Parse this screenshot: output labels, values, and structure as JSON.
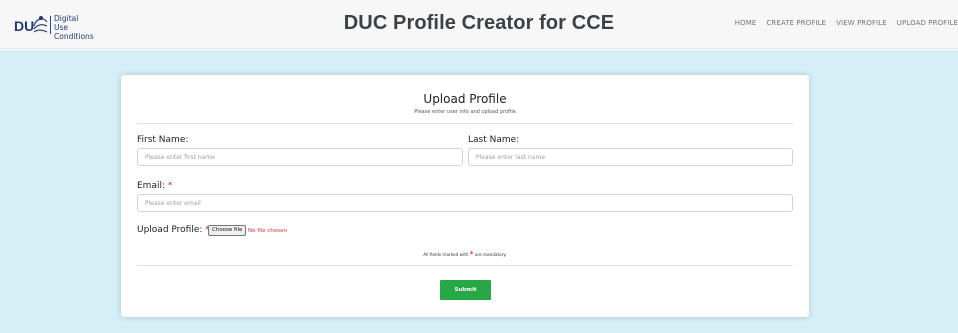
{
  "header": {
    "logo": {
      "mark": "DU",
      "line1": "Digital Use",
      "line2": "Conditions"
    },
    "title": "DUC Profile Creator for CCE",
    "nav": [
      "HOME",
      "CREATE PROFILE",
      "VIEW PROFILE",
      "UPLOAD PROFILE"
    ]
  },
  "form": {
    "title": "Upload Profile",
    "subtitle": "Please enter user info and upload profile",
    "first_name": {
      "label": "First Name:",
      "placeholder": "Please enter first name",
      "value": ""
    },
    "last_name": {
      "label": "Last Name:",
      "placeholder": "Please enter last name",
      "value": ""
    },
    "email": {
      "label": "Email:",
      "required": "*",
      "placeholder": "Please enter email",
      "value": ""
    },
    "upload": {
      "label": "Upload Profile:",
      "required": "*",
      "button_label": "Choose file",
      "status": "No file chosen"
    },
    "mandatory_note": {
      "prefix": "All fields marked with",
      "star": "*",
      "suffix": "are mandatory."
    },
    "submit_label": "Submit"
  },
  "colors": {
    "background": "#d4eff6",
    "header_bg": "#f7f7f7",
    "required": "#d9302c",
    "submit": "#28a745",
    "logo_blue": "#1f3a7a"
  }
}
